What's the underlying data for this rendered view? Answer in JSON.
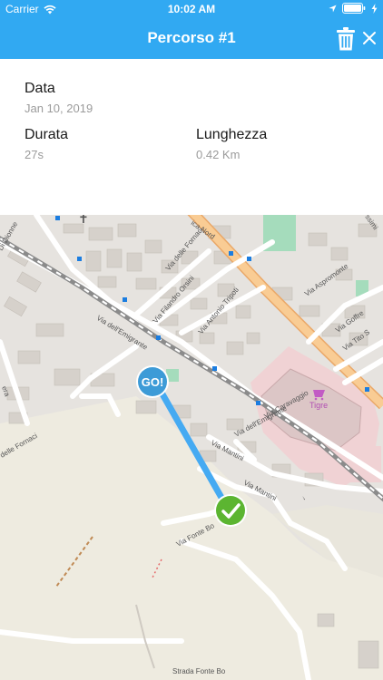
{
  "status_bar": {
    "carrier": "Carrier",
    "time": "10:02 AM"
  },
  "header": {
    "title": "Percorso #1",
    "background_color": "#31a9f2"
  },
  "details": {
    "date_label": "Data",
    "date_value": "Jan 10, 2019",
    "duration_label": "Durata",
    "duration_value": "27s",
    "length_label": "Lunghezza",
    "length_value": "0.42 Km"
  },
  "map": {
    "start_marker_label": "GO!",
    "start_marker_color": "#3d9bd7",
    "end_marker_color": "#5cb531",
    "route_color": "#45aaf2",
    "poi_name": "Tigre",
    "street_labels": {
      "via_emigrante_1": "Via dell'Emigrante",
      "via_emigrante_2": "Via dell'Emigrante",
      "via_fornaci_1": "Via delle Fornaci",
      "via_fornaci_2": "delle Fornaci",
      "via_filandro": "Via Filandro Orsini",
      "via_tripoti": "Via Antonio Tripoti",
      "via_caravaggio": "Via Caravaggio",
      "via_mantini_1": "Via Mantini",
      "via_mantini_2": "Via Mantini",
      "via_fonte_bo": "Via Fonte Bo",
      "strada_fonte": "Strada Fonte Bo",
      "via_aspromonte": "Via Aspromonte",
      "via_goffredo": "Via Goffre",
      "via_tito": "Via Tito S",
      "via_nord": "ica Nord",
      "dionne": "Di Dionne",
      "era": "era",
      "ssimi": "ssimi"
    }
  }
}
